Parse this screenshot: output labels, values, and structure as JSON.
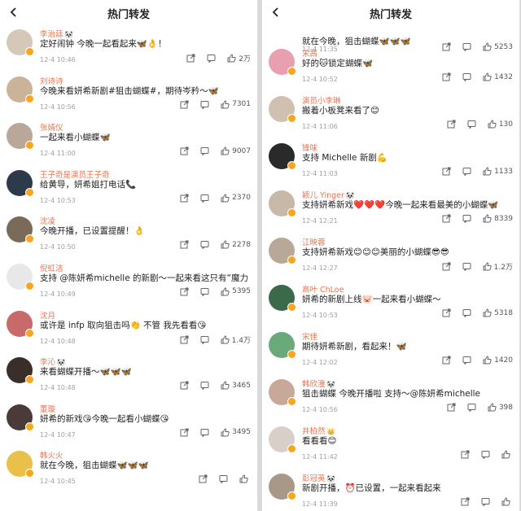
{
  "page_title": "热门转发",
  "left": {
    "items": [
      {
        "name": "李治廷",
        "tag": "🐼",
        "text": "定好闹钟 今晚一起看起来🦋👌！",
        "meta": "12-4 10:46",
        "likes": "2万",
        "color": "#d6c8b8"
      },
      {
        "name": "刘诗诗",
        "tag": "",
        "text": "今晚来看妍希新剧#狙击蝴蝶#，期待岑矜～🦋",
        "meta": "12-4 10:56",
        "likes": "7301",
        "color": "#c9b49a"
      },
      {
        "name": "张婧仪",
        "tag": "",
        "text": "一起来看小蝴蝶🦋",
        "meta": "12-4 11:00",
        "likes": "9007",
        "color": "#b9a89a"
      },
      {
        "name": "王子奇是演员王子奇",
        "tag": "",
        "text": "给黄导，妍希姐打电话📞",
        "meta": "12-4 10:53",
        "likes": "2370",
        "color": "#2d3a4a"
      },
      {
        "name": "沈凌",
        "tag": "",
        "text": "今晚开播，已设置提醒！👌",
        "meta": "12-4 10:50",
        "likes": "2278",
        "color": "#7a6a5a"
      },
      {
        "name": "倪虹洁",
        "tag": "",
        "text": "支持 @陈妍希michelle 的新剧～一起来看这只有“魔力”的小蝴蝶🦋～",
        "meta": "12-4 10:49",
        "likes": "5395",
        "color": "#e8e8e8"
      },
      {
        "name": "沈月",
        "tag": "",
        "text": "或许是 infp 取向狙击吗👏 不管 我先看看😘",
        "meta": "12-4 10:48",
        "likes": "1.4万",
        "color": "#c96a6a"
      },
      {
        "name": "李沁",
        "tag": "🐼",
        "text": "来看蝴蝶开播～🦋🦋🦋",
        "meta": "12-4 10:48",
        "likes": "3465",
        "color": "#3a2e2a"
      },
      {
        "name": "董璇",
        "tag": "",
        "text": "妍希的新戏😘今晚一起看小蝴蝶😘",
        "meta": "12-4 10:47",
        "likes": "3495",
        "color": "#4a3a3a"
      },
      {
        "name": "韩火火",
        "tag": "",
        "text": "就在今晚，狙击蝴蝶🦋🦋🦋",
        "meta": "12-4 10:45",
        "likes": "",
        "color": "#e8c04a"
      }
    ]
  },
  "right": {
    "folded": {
      "text": "就在今晚，狙击蝴蝶🦋🦋🦋",
      "meta": "12-4 11:35",
      "likes": "5253"
    },
    "items": [
      {
        "name": "宋茜",
        "tag": "",
        "text": "好的🐱锁定蝴蝶🦋",
        "meta": "12-4 10:52",
        "likes": "1432",
        "color": "#e8a0b0"
      },
      {
        "name": "演员小李琳",
        "tag": "",
        "text": "搬着小板凳来看了😊",
        "meta": "12-4 11:06",
        "likes": "130",
        "color": "#d0c0b0"
      },
      {
        "name": "锋味",
        "tag": "",
        "text": "支持 Michelle 新剧💪",
        "meta": "12-4 11:03",
        "likes": "1133",
        "color": "#2a2a2a"
      },
      {
        "name": "颖儿 Yinger",
        "tag": "🐼",
        "text": "支持妍希新戏❤️❤️❤️今晚一起来看最美的小蝴蝶🦋",
        "meta": "12-4 12:21",
        "likes": "8339",
        "color": "#c8b8a8"
      },
      {
        "name": "江映蓉",
        "tag": "",
        "text": "支持妍希新戏😊😊😊美丽的小蝴蝶😎😎",
        "meta": "12-4 12:27",
        "likes": "1.2万",
        "color": "#b8a898"
      },
      {
        "name": "高叶 ChLoe",
        "tag": "",
        "text": "妍希的新剧上线🐷一起来看小蝴蝶～",
        "meta": "12-4 10:53",
        "likes": "5318",
        "color": "#3a6a4a"
      },
      {
        "name": "宋佳",
        "tag": "",
        "text": "期待妍希新剧，看起来！🦋",
        "meta": "12-4 12:02",
        "likes": "1420",
        "color": "#6aaa7a"
      },
      {
        "name": "韩欣潼",
        "tag": "🐼",
        "text": "狙击蝴蝶 今晚开播啦 支持～@陈妍希michelle",
        "meta": "12-4 10:56",
        "likes": "398",
        "color": "#c8a898"
      },
      {
        "name": "井柏然",
        "tag": "👑",
        "text": "看看看😊",
        "meta": "12-4 11:42",
        "likes": "",
        "color": "#d8d0c8"
      },
      {
        "name": "彭冠英",
        "tag": "🐼",
        "text": "新剧开播，⏰已设置，一起来看起来",
        "meta": "12-4 11:39",
        "likes": "",
        "color": "#a89888"
      }
    ]
  },
  "icons": {
    "back": "chevron-left-icon",
    "share": "share-icon",
    "comment": "comment-icon",
    "like": "thumbs-up-icon"
  }
}
